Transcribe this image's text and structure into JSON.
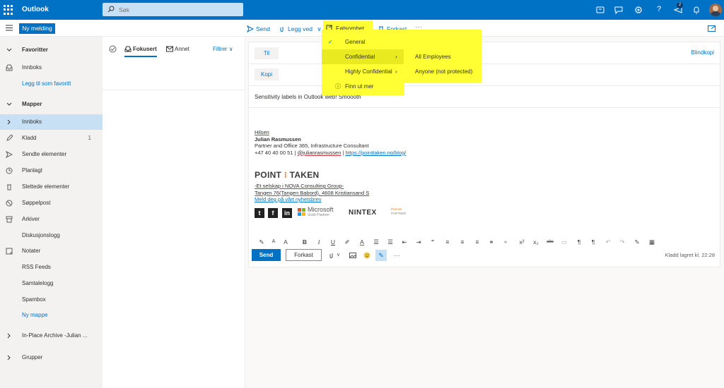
{
  "topbar": {
    "brand": "Outlook",
    "search_placeholder": "Søk",
    "notification_count": "2"
  },
  "cmdbar": {
    "new_message": "Ny melding",
    "send": "Send",
    "attach": "Legg ved",
    "sensitivity": "Følsomhet",
    "discard": "Forkast",
    "more": "···"
  },
  "sensitivity_menu": {
    "items": [
      {
        "label": "General"
      },
      {
        "label": "Confidential"
      },
      {
        "label": "Highly Confidential"
      },
      {
        "label": "Finn ut mer"
      }
    ],
    "submenu": [
      {
        "label": "All Employees"
      },
      {
        "label": "Anyone (not protected)"
      }
    ]
  },
  "sidebar": {
    "favorites": "Favoritter",
    "inbox_fav": "Innboks",
    "add_favorite": "Legg til som favoritt",
    "folders": "Mapper",
    "items": [
      {
        "label": "Innboks",
        "count": ""
      },
      {
        "label": "Kladd",
        "count": "1"
      },
      {
        "label": "Sendte elementer",
        "count": ""
      },
      {
        "label": "Planlagt",
        "count": ""
      },
      {
        "label": "Slettede elementer",
        "count": ""
      },
      {
        "label": "Søppelpost",
        "count": ""
      },
      {
        "label": "Arkiver",
        "count": ""
      },
      {
        "label": "Diskusjonslogg",
        "count": ""
      },
      {
        "label": "Notater",
        "count": ""
      },
      {
        "label": "RSS Feeds",
        "count": ""
      },
      {
        "label": "Samtalelogg",
        "count": ""
      },
      {
        "label": "Spambox",
        "count": ""
      }
    ],
    "new_folder": "Ny mappe",
    "archive": "In-Place Archive -Julian ...",
    "groups": "Grupper"
  },
  "msglist": {
    "tab_focused": "Fokusert",
    "tab_other": "Annet",
    "filter": "Filtrer"
  },
  "compose": {
    "to": "Til",
    "cc": "Kopi",
    "bcc": "Blindkopi",
    "subject": "Sensitivity labels in Outlook web! Smoooth",
    "sig_greeting": "Hilsen",
    "sig_name": "Julian Rasmussen",
    "sig_title": "Partner and Office 365, Infrastructure Consultant",
    "sig_phone": "+47 40 40 00 51",
    "sig_twitter": "@julianrasmussen",
    "sig_url": "https://pointtaken.no/blog/",
    "logo_left": "POINT",
    "logo_right": "TAKEN",
    "sig_company": "-Et selskap i NOVA Consulting Group-",
    "sig_address": "Tangen 76(Tangen Babord), 4608 Kristiansand S",
    "sig_newsletter": "Meld deg på vårt nyhetsbrev",
    "ms_text": "Microsoft",
    "ms_sub": "Gold Partner",
    "nintex": "NINTEX",
    "premier": "Premier",
    "partner": "PARTNER",
    "send": "Send",
    "discard": "Forkast",
    "draft_status": "Kladd lagret kl. 22:28"
  },
  "colors": {
    "accent": "#0072c6",
    "highlight": "#ffff33"
  }
}
